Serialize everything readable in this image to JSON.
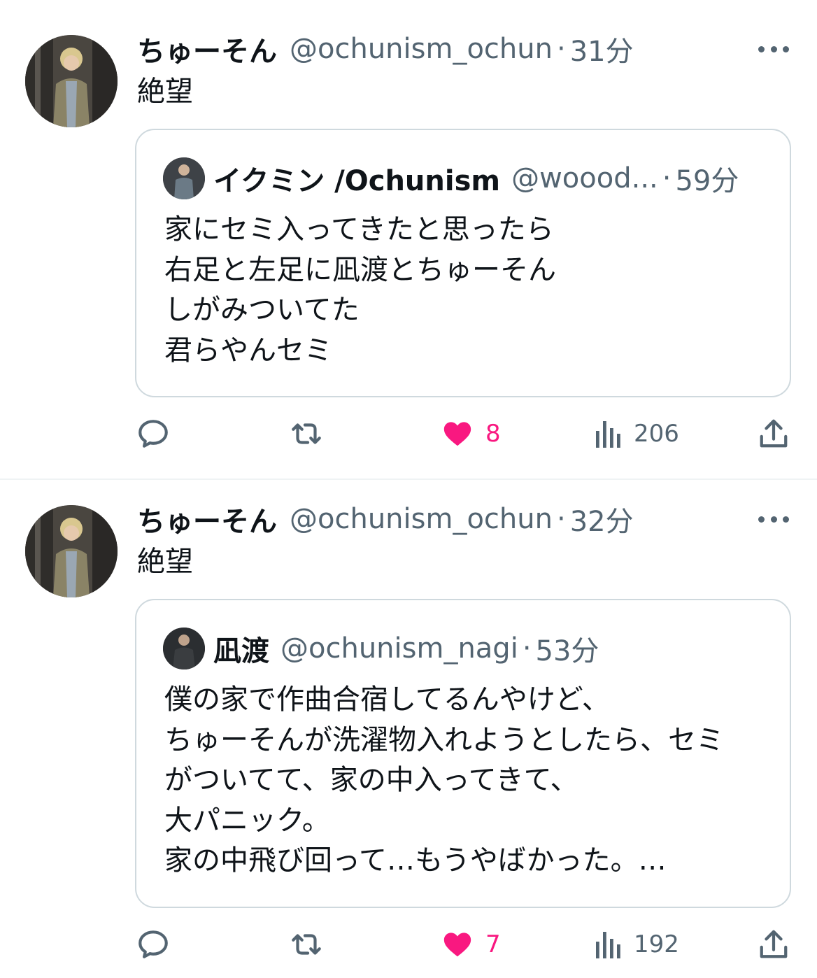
{
  "tweets": [
    {
      "author_name": "ちゅーそん",
      "author_handle": "@ochunism_ochun",
      "separator": "·",
      "time": "31分",
      "text": "絶望",
      "quote": {
        "author_name": "イクミン /Ochunism",
        "author_handle": "@woood...",
        "separator": "·",
        "time": "59分",
        "lines": [
          "家にセミ入ってきたと思ったら",
          "右足と左足に凪渡とちゅーそん",
          "しがみついてた",
          "君らやんセミ"
        ]
      },
      "likes": "8",
      "views": "206"
    },
    {
      "author_name": "ちゅーそん",
      "author_handle": "@ochunism_ochun",
      "separator": "·",
      "time": "32分",
      "text": "絶望",
      "quote": {
        "author_name": "凪渡",
        "author_handle": "@ochunism_nagi",
        "separator": "·",
        "time": "53分",
        "lines": [
          "僕の家で作曲合宿してるんやけど、",
          "ちゅーそんが洗濯物入れようとしたら、セミ",
          "がついてて、家の中入ってきて、",
          "大パニック。",
          "家の中飛び回って…もうやばかった。…"
        ]
      },
      "likes": "7",
      "views": "192"
    }
  ],
  "icons": {
    "reply": "reply-icon",
    "retweet": "retweet-icon",
    "like": "heart-icon",
    "views": "views-icon",
    "share": "share-icon",
    "more": "more-icon"
  },
  "colors": {
    "like": "#f91880",
    "secondary_text": "#536471",
    "border": "#cfd9de"
  }
}
